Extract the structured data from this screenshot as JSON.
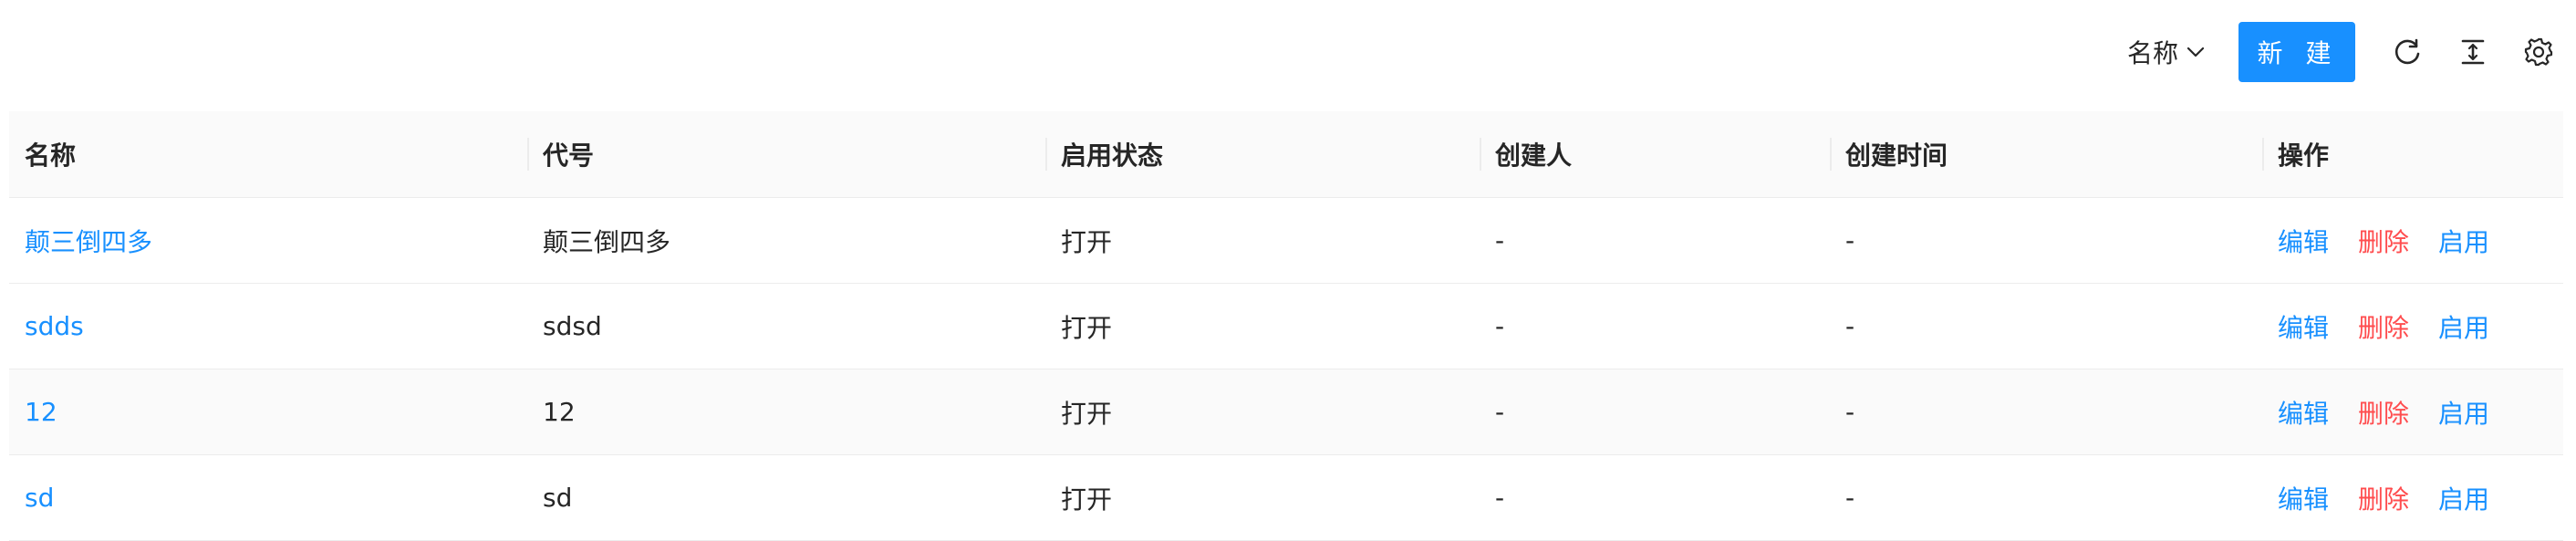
{
  "toolbar": {
    "sort_label": "名称",
    "new_button_label": "新 建",
    "icons": [
      "chevron-down-icon",
      "reload-icon",
      "column-height-icon",
      "settings-icon"
    ]
  },
  "table": {
    "columns": [
      "名称",
      "代号",
      "启用状态",
      "创建人",
      "创建时间",
      "操作"
    ],
    "rows": [
      {
        "name": "颠三倒四多",
        "code": "颠三倒四多",
        "status": "打开",
        "creator": "-",
        "created_at": "-"
      },
      {
        "name": "sdds",
        "code": "sdsd",
        "status": "打开",
        "creator": "-",
        "created_at": "-"
      },
      {
        "name": "12",
        "code": "12",
        "status": "打开",
        "creator": "-",
        "created_at": "-"
      },
      {
        "name": "sd",
        "code": "sd",
        "status": "打开",
        "creator": "-",
        "created_at": "-"
      }
    ],
    "actions": {
      "edit": "编辑",
      "delete": "删除",
      "enable": "启用"
    }
  },
  "colors": {
    "primary": "#1890ff",
    "danger": "#ff4d4f",
    "header_bg": "#fafafa"
  }
}
